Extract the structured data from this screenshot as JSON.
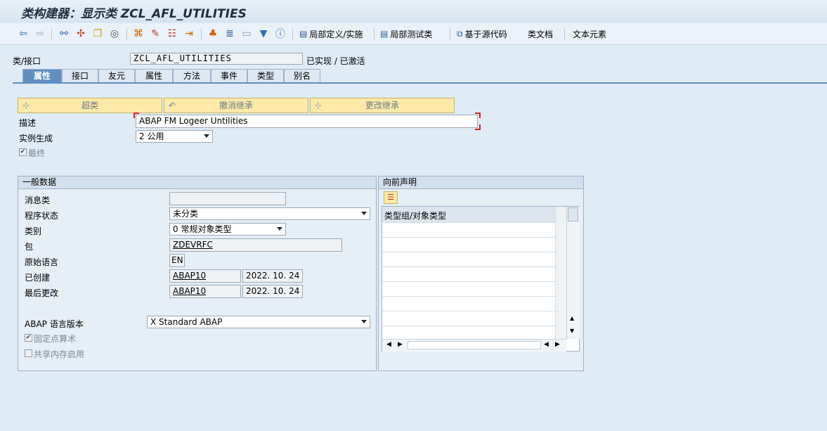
{
  "window": {
    "title": "类构建器：显示类 ZCL_AFL_UTILITIES"
  },
  "toolbar": {
    "local_def_label": "局部定义/实施",
    "local_test_label": "局部测试类",
    "source_label": "基于源代码",
    "class_doc_label": "类文档",
    "text_elements_label": "文本元素"
  },
  "header": {
    "class_label": "类/接口",
    "class_value": "ZCL_AFL_UTILITIES",
    "status_text": "已实现 / 已激活"
  },
  "tabs": [
    "属性",
    "接口",
    "友元",
    "属性",
    "方法",
    "事件",
    "类型",
    "别名"
  ],
  "buttons": {
    "superclass": "超类",
    "undo_inherit": "撤消继承",
    "change_inherit": "更改继承"
  },
  "props": {
    "desc_label": "描述",
    "desc_value": "ABAP FM Logeer Untilities",
    "instgen_label": "实例生成",
    "instgen_value": "2 公用",
    "final_label": "最终"
  },
  "general": {
    "header": "一般数据",
    "msgclass_label": "消息类",
    "msgclass_value": "",
    "progstatus_label": "程序状态",
    "progstatus_value": "未分类",
    "category_label": "类别",
    "category_value": "0 常规对象类型",
    "package_label": "包",
    "package_value": "ZDEVRFC",
    "origlang_label": "原始语言",
    "origlang_value": "EN",
    "created_label": "已创建",
    "created_user": "ABAP10",
    "created_date": "2022. 10. 24",
    "changed_label": "最后更改",
    "changed_user": "ABAP10",
    "changed_date": "2022. 10. 24",
    "abapver_label": "ABAP 语言版本",
    "abapver_value": "X Standard ABAP",
    "fixedpt_label": "固定点算术",
    "sharedmem_label": "共享内存启用"
  },
  "forward": {
    "header": "向前声明",
    "column": "类型组/对象类型"
  },
  "colors": {
    "tab_active": "#5f8fbf",
    "button_yellow": "#fde9a8",
    "background": "#dfebf5"
  }
}
